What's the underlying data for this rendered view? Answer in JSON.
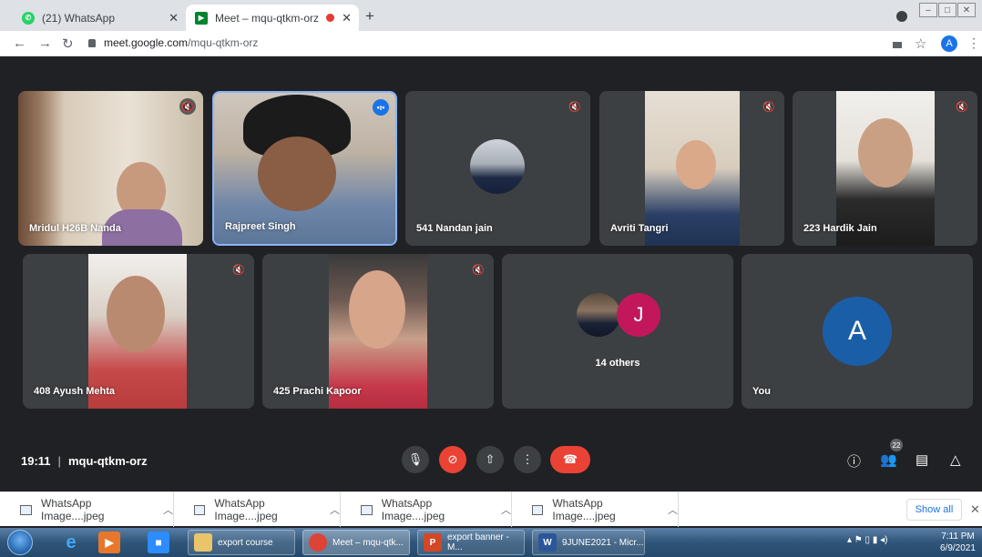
{
  "browser": {
    "tabs": [
      {
        "title": "(21) WhatsApp",
        "favicon": "whatsapp-icon"
      },
      {
        "title": "Meet – mqu-qtkm-orz",
        "favicon": "meet-icon",
        "recording": true
      }
    ],
    "new_tab": "+",
    "url": {
      "host": "meet.google.com",
      "path": "/mqu-qtkm-orz"
    },
    "profile_letter": "A"
  },
  "participants": [
    {
      "name": "Mridul H26B Nanda",
      "muted": true
    },
    {
      "name": "Rajpreet Singh",
      "muted": false,
      "speaking": true
    },
    {
      "name": "541 Nandan jain",
      "muted": true
    },
    {
      "name": "Avriti Tangri",
      "muted": true
    },
    {
      "name": "223 Hardik Jain",
      "muted": true
    },
    {
      "name": "408 Ayush Mehta",
      "muted": true
    },
    {
      "name": "425 Prachi Kapoor",
      "muted": true
    }
  ],
  "others": {
    "initial": "J",
    "label": "14 others",
    "color": "#c2185b"
  },
  "self": {
    "initial": "A",
    "label": "You",
    "color": "#1a5ea8"
  },
  "meeting": {
    "time": "19:11",
    "separator": "|",
    "code": "mqu-qtkm-orz",
    "people_count": "22"
  },
  "downloads": {
    "items": [
      {
        "name": "WhatsApp Image....jpeg"
      },
      {
        "name": "WhatsApp Image....jpeg"
      },
      {
        "name": "WhatsApp Image....jpeg"
      },
      {
        "name": "WhatsApp Image....jpeg"
      }
    ],
    "show_all": "Show all"
  },
  "taskbar": {
    "tasks": [
      {
        "label": "export course"
      },
      {
        "label": "Meet – mqu-qtk..."
      },
      {
        "label": "export banner - M..."
      },
      {
        "label": "9JUNE2021 - Micr..."
      }
    ],
    "time": "7:11 PM",
    "date": "6/9/2021"
  },
  "colors": {
    "accent": "#1a73e8",
    "danger": "#ea4335",
    "tile": "#3c4043",
    "background": "#202124"
  }
}
